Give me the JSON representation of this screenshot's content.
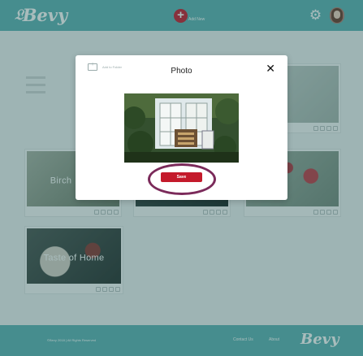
{
  "header": {
    "logo_text": "Bevy",
    "add_new_label": "Add New"
  },
  "cards": [
    {
      "title": ""
    },
    {
      "title": "Birch"
    },
    {
      "title": ""
    },
    {
      "title": ""
    },
    {
      "title": "Taste of Home"
    }
  ],
  "modal": {
    "add_to_folder_label": "Add to Folder",
    "title": "Photo",
    "close_glyph": "✕",
    "save_label": "Save"
  },
  "footer": {
    "copyright": "©Bevy 2018 | All Rights Reserved",
    "contact_label": "Contact Us",
    "about_label": "About",
    "logo_text": "Bevy"
  },
  "colors": {
    "brand_teal": "#5fb4b5",
    "accent_red": "#c41a2b",
    "highlight_ring": "#7b2a5a"
  }
}
